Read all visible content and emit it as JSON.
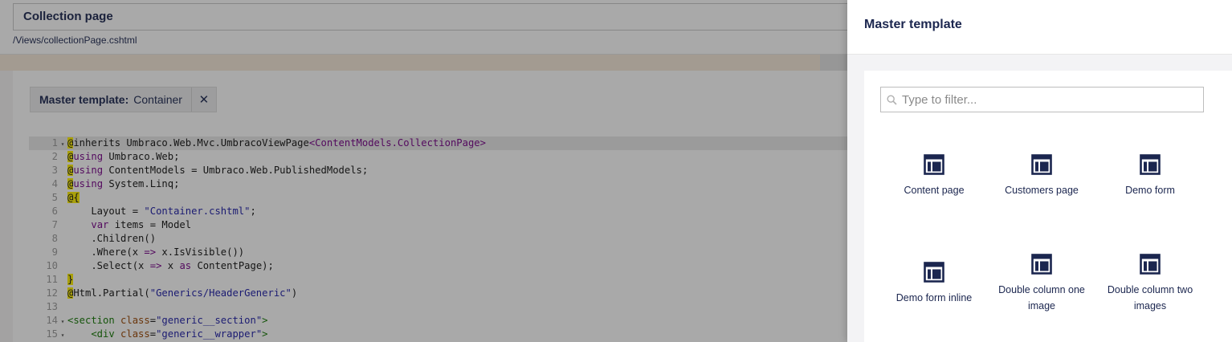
{
  "editor": {
    "template_name": "Collection page",
    "path": "/Views/collectionPage.cshtml",
    "master_label": "Master template:",
    "master_value": "Container",
    "remove_master_symbol": "✕"
  },
  "code_lines": [
    {
      "n": "1",
      "fold": true
    },
    {
      "n": "2"
    },
    {
      "n": "3"
    },
    {
      "n": "4"
    },
    {
      "n": "5"
    },
    {
      "n": "6"
    },
    {
      "n": "7"
    },
    {
      "n": "8"
    },
    {
      "n": "9"
    },
    {
      "n": "10"
    },
    {
      "n": "11"
    },
    {
      "n": "12"
    },
    {
      "n": "13"
    },
    {
      "n": "14",
      "fold": true
    },
    {
      "n": "15",
      "fold": true
    }
  ],
  "code": {
    "l1": [
      "@",
      "inherits Umbraco.Web.Mvc.UmbracoViewPage",
      "<ContentModels.CollectionPage>"
    ],
    "l2": [
      "@",
      "using",
      " Umbraco.Web;"
    ],
    "l3": [
      "@",
      "using",
      " ContentModels = Umbraco.Web.PublishedModels;"
    ],
    "l4": [
      "@",
      "using",
      " System.Linq;"
    ],
    "l5": [
      "@{"
    ],
    "l6": [
      "    Layout = ",
      "\"Container.cshtml\"",
      ";"
    ],
    "l7": [
      "    ",
      "var",
      " items = Model"
    ],
    "l8": [
      "    .Children()"
    ],
    "l9": [
      "    .Where(x ",
      "=>",
      " x.IsVisible())"
    ],
    "l10": [
      "    .Select(x ",
      "=>",
      " x ",
      "as",
      " ContentPage);"
    ],
    "l11": [
      "}"
    ],
    "l12": [
      "@",
      "Html.Partial(",
      "\"Generics/HeaderGeneric\"",
      ")"
    ],
    "l13": [
      ""
    ],
    "l14": [
      "<section",
      " class",
      "=",
      "\"generic__section\"",
      ">"
    ],
    "l15": [
      "    <div",
      " class",
      "=",
      "\"generic__wrapper\"",
      ">"
    ]
  },
  "dialog": {
    "title": "Master template",
    "filter_placeholder": "Type to filter...",
    "filter_value": "",
    "items": [
      {
        "label": "Content page"
      },
      {
        "label": "Customers page"
      },
      {
        "label": "Demo form"
      },
      {
        "label": "Demo form inline"
      },
      {
        "label": "Double column one image"
      },
      {
        "label": "Double column two images"
      }
    ]
  },
  "colors": {
    "brand_navy": "#1b264f",
    "overlay": "rgba(30,30,30,0.38)",
    "at_highlight": "#fff000",
    "keyword": "#770088",
    "string": "#1a1aa6",
    "html_tag": "#117700",
    "html_attr": "#994500"
  },
  "icons": {
    "template": "template-layout-icon",
    "search": "search-icon",
    "remove": "close-icon",
    "fold": "fold-arrow-icon"
  }
}
